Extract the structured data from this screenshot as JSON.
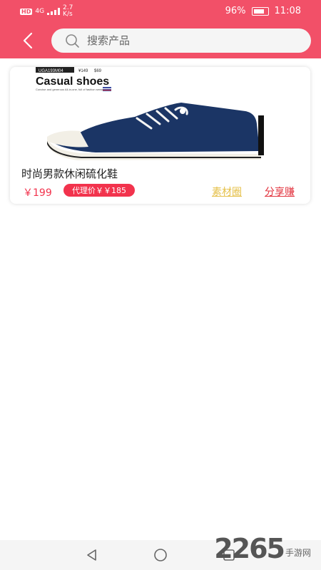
{
  "status_bar": {
    "hd_badge": "HD",
    "network": "4G",
    "speed_value": "2.7",
    "speed_unit": "K/s",
    "battery_percent": "96%",
    "time": "11:08"
  },
  "header": {
    "bg_color": "#f25068",
    "back_icon": "chevron-left-icon",
    "search": {
      "placeholder": "搜索产品",
      "value": ""
    }
  },
  "product": {
    "image": {
      "code": "UGA193M04",
      "price_tag_1": "¥149",
      "price_tag_2": "$69",
      "headline": "Casual shoes",
      "subline": "Concise and generous All-in-one, full of fashion sense"
    },
    "title": "时尚男款休闲硫化鞋",
    "price": "￥199",
    "agent_price": "代理价￥￥185",
    "materials_link": "素材圈",
    "share_link": "分享赚"
  },
  "bottom_nav": {
    "back": "triangle-back-icon",
    "home": "circle-home-icon",
    "recents": "square-recents-icon"
  },
  "watermark": {
    "number": "2265",
    "text": "手游网"
  }
}
